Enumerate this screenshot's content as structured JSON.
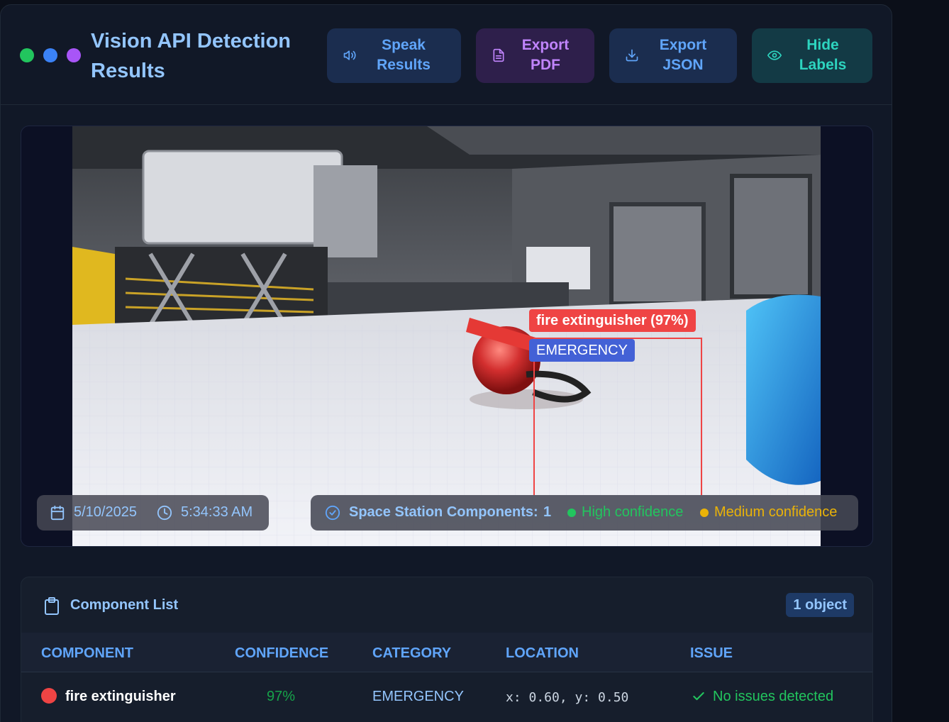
{
  "header": {
    "title": "Vision API Detection Results",
    "window_dots": [
      "#22c55e",
      "#3b82f6",
      "#a855f7"
    ],
    "buttons": {
      "speak": {
        "label": "Speak\nResults",
        "icon": "speaker-icon"
      },
      "pdf": {
        "label": "Export\nPDF",
        "icon": "document-icon"
      },
      "json": {
        "label": "Export\nJSON",
        "icon": "download-icon"
      },
      "hide": {
        "label": "Hide\nLabels",
        "icon": "eye-icon"
      }
    }
  },
  "viewer": {
    "date": "5/10/2025",
    "time": "5:34:33 AM",
    "components_label": "Space Station Components:",
    "components_count": "1",
    "legend_high": "High confidence",
    "legend_medium": "Medium confidence",
    "colors": {
      "high": "#22c55e",
      "medium": "#eab308"
    },
    "detection": {
      "label": "fire extinguisher (97%)",
      "category": "EMERGENCY",
      "box_color": "#ef4444"
    }
  },
  "list": {
    "title": "Component List",
    "count": "1 object",
    "columns": [
      "COMPONENT",
      "CONFIDENCE",
      "CATEGORY",
      "LOCATION",
      "ISSUE"
    ],
    "rows": [
      {
        "component": "fire extinguisher",
        "confidence": "97%",
        "category": "EMERGENCY",
        "location": "x: 0.60, y: 0.50",
        "issue": "No issues detected"
      }
    ]
  }
}
